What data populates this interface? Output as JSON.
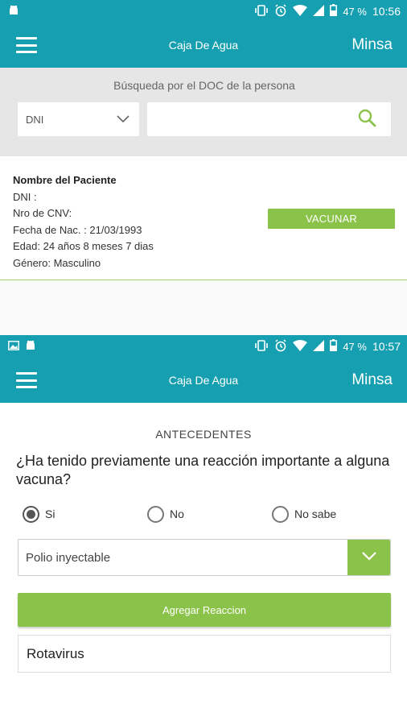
{
  "screen1": {
    "status": {
      "battery": "47 %",
      "time": "10:56"
    },
    "appbar": {
      "title": "Caja De Agua",
      "brand": "Minsa"
    },
    "search": {
      "caption": "Búsqueda por el DOC de la persona",
      "doc_type": "DNI",
      "input_value": ""
    },
    "patient": {
      "heading": "Nombre del Paciente",
      "dni": "DNI :",
      "cnv": "Nro de CNV:",
      "birth": "Fecha de Nac. : 21/03/1993",
      "age": "Edad: 24 años 8 meses 7 dias",
      "gender": "Género: Masculino"
    },
    "vaccinate_label": "VACUNAR"
  },
  "screen2": {
    "status": {
      "battery": "47 %",
      "time": "10:57"
    },
    "appbar": {
      "title": "Caja De Agua",
      "brand": "Minsa"
    },
    "section_title": "ANTECEDENTES",
    "question": "¿Ha tenido previamente una reacción importante a alguna vacuna?",
    "options": [
      {
        "label": "Si",
        "selected": true
      },
      {
        "label": "No",
        "selected": false
      },
      {
        "label": "No sabe",
        "selected": false
      }
    ],
    "vaccine_select": "Polio inyectable",
    "add_label": "Agregar Reaccion",
    "reactions": [
      "Rotavirus"
    ]
  },
  "colors": {
    "primary": "#159fb0",
    "accent": "#8bc34a"
  }
}
